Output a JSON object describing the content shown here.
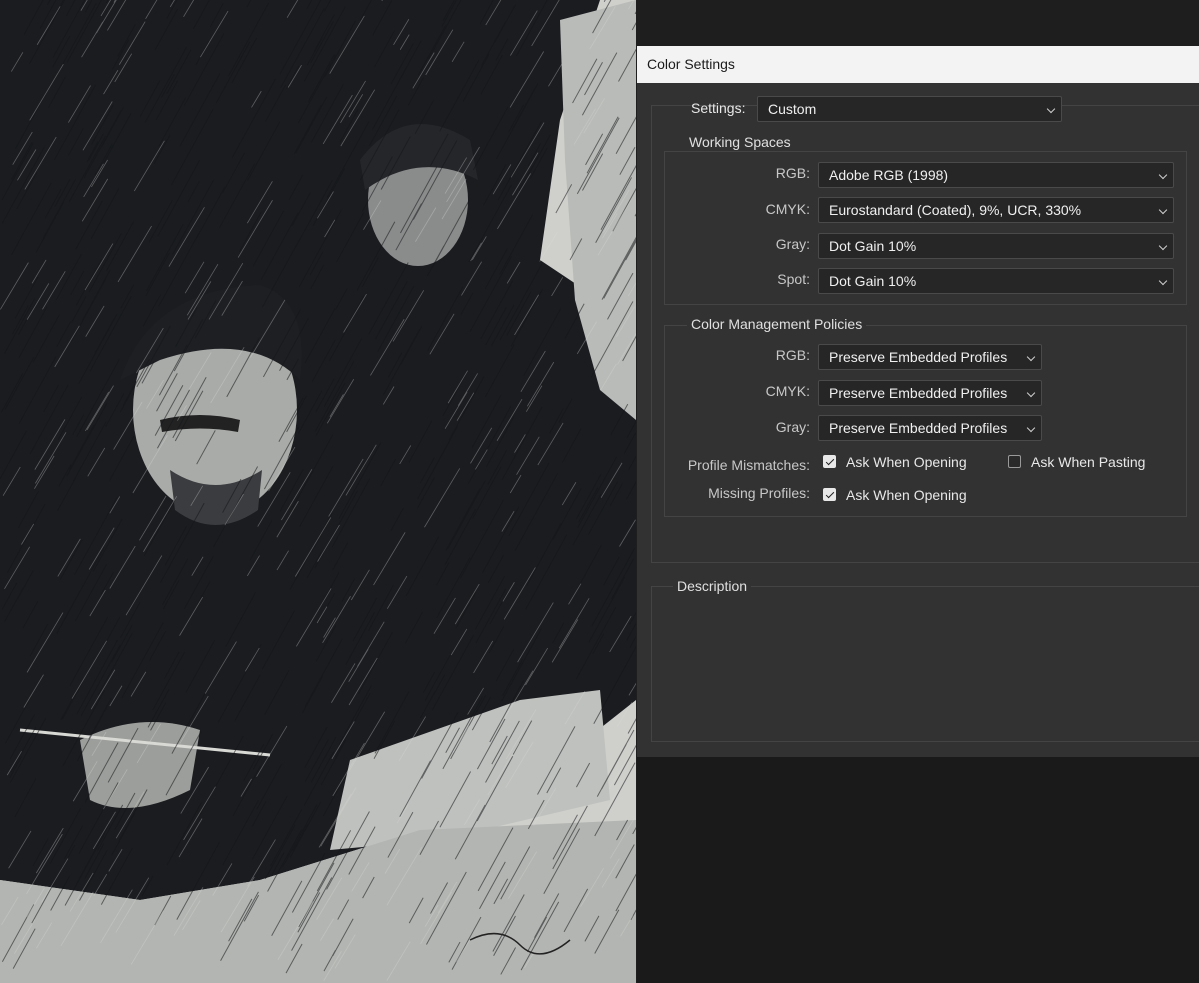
{
  "window": {
    "title": "Color Settings"
  },
  "settings": {
    "label": "Settings:",
    "value": "Custom"
  },
  "working_spaces": {
    "title": "Working Spaces",
    "rgb": {
      "label": "RGB:",
      "value": "Adobe RGB (1998)"
    },
    "cmyk": {
      "label": "CMYK:",
      "value": "Eurostandard (Coated), 9%, UCR, 330%"
    },
    "gray": {
      "label": "Gray:",
      "value": "Dot Gain 10%"
    },
    "spot": {
      "label": "Spot:",
      "value": "Dot Gain 10%"
    }
  },
  "policies": {
    "title": "Color Management Policies",
    "rgb": {
      "label": "RGB:",
      "value": "Preserve Embedded Profiles"
    },
    "cmyk": {
      "label": "CMYK:",
      "value": "Preserve Embedded Profiles"
    },
    "gray": {
      "label": "Gray:",
      "value": "Preserve Embedded Profiles"
    },
    "profile_mismatches": {
      "label": "Profile Mismatches:",
      "ask_opening": {
        "label": "Ask When Opening",
        "checked": true
      },
      "ask_pasting": {
        "label": "Ask When Pasting",
        "checked": false
      }
    },
    "missing_profiles": {
      "label": "Missing Profiles:",
      "ask_opening": {
        "label": "Ask When Opening",
        "checked": true
      }
    }
  },
  "description": {
    "title": "Description"
  },
  "colors": {
    "dialog_bg": "#323232",
    "titlebar_bg": "#f3f3f3",
    "field_bg": "#262626",
    "artwork_paper": "#cfd0cc",
    "artwork_ink": "#141619"
  },
  "artwork": {
    "icon": "pen-and-ink-portrait-etching"
  }
}
